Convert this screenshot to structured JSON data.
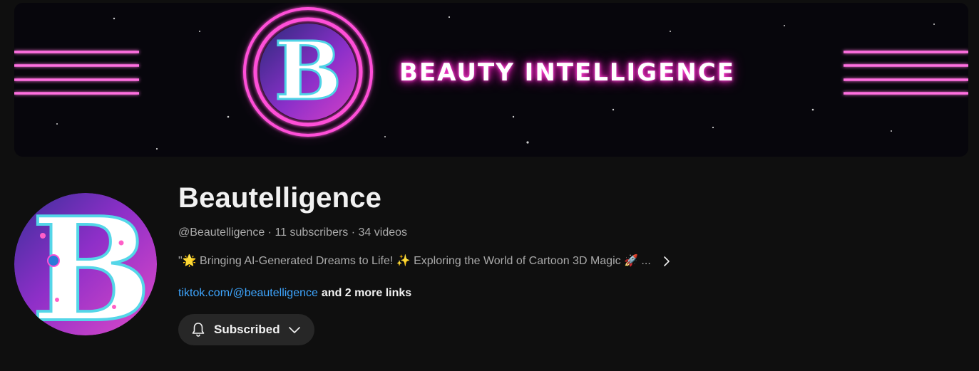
{
  "banner": {
    "title_text": "BEAUTY INTELLIGENCE",
    "logo_letter": "B",
    "neon_color": "#ff3fd2"
  },
  "channel": {
    "name": "Beautelligence",
    "handle": "@Beautelligence",
    "separator": " · ",
    "subscribers": "11 subscribers",
    "videos": "34 videos",
    "description": "\"🌟 Bringing AI-Generated Dreams to Life! ✨ Exploring the World of Cartoon 3D Magic 🚀 ...",
    "link_text": "tiktok.com/@beautelligence",
    "more_links": "and 2 more links"
  },
  "subscribe_button": {
    "label": "Subscribed",
    "bell_icon": "bell-icon",
    "dropdown_icon": "chevron-down-icon"
  },
  "colors": {
    "background": "#0f0f0f",
    "link": "#3ea6ff",
    "secondary_text": "#aaaaaa",
    "button_bg": "#272727"
  }
}
